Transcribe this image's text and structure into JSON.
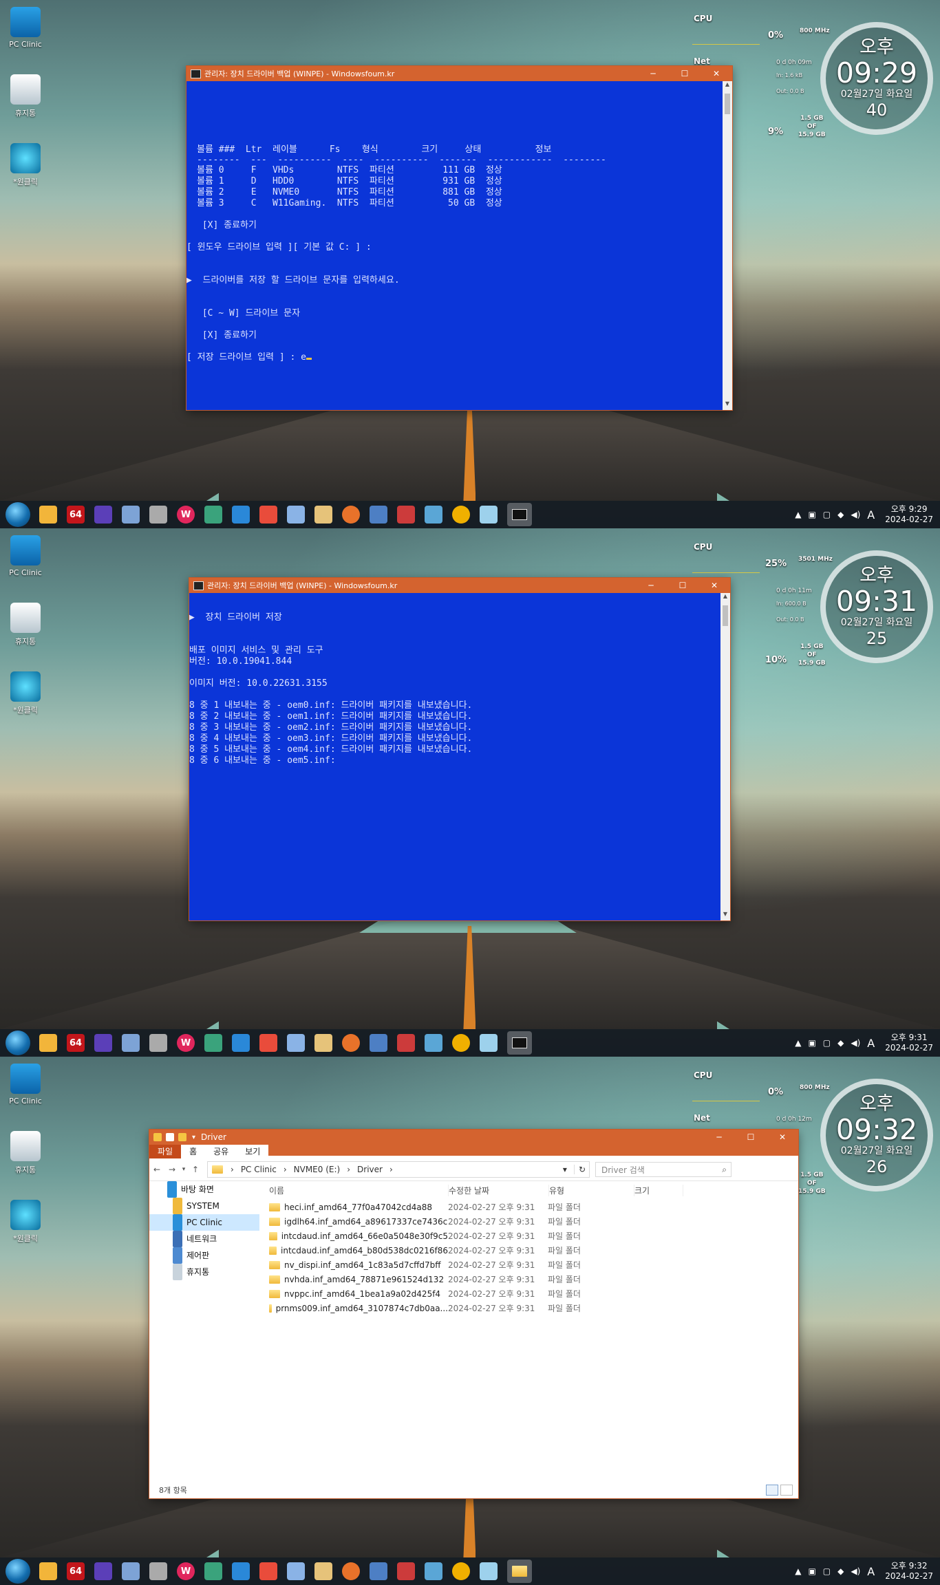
{
  "desktop": {
    "icons": [
      {
        "label": "PC Clinic"
      },
      {
        "label": "휴지통"
      },
      {
        "label": "*원클릭"
      }
    ]
  },
  "taskbar": {
    "icons": [
      "64",
      "W"
    ],
    "tray_lang": "A"
  },
  "gadgets": {
    "cpu_label": "CPU",
    "net_label": "Net",
    "mem_line1": "1.5 GB",
    "mem_line2": "OF",
    "mem_line3": "15.9 GB"
  },
  "panels": [
    {
      "clock": {
        "ampm": "오후",
        "time": "09:29",
        "date": "02월27일 화요일",
        "seconds": "40"
      },
      "taskbar_time": "오후 9:29",
      "taskbar_date": "2024-02-27",
      "cpu_pct": "0%",
      "cpu_mhz": "800 MHz",
      "net_uptime": "0 d 0h 09m",
      "net_in": "In: 1.6 kB",
      "net_out": "Out: 0.0 B",
      "mem_pct": "9%",
      "window_title": "관리자:  장치 드라이버 백업 (WINPE) - Windowsfoum.kr",
      "console_lines": [
        "볼륨 ###  Ltr  레이블      Fs    형식        크기     상태          정보",
        "--------  ---  ----------  ----  ----------  -------  ------------  --------",
        "볼륨 0     F   VHDs        NTFS  파티션         111 GB  정상",
        "볼륨 1     D   HDD0        NTFS  파티션         931 GB  정상",
        "볼륨 2     E   NVME0       NTFS  파티션         881 GB  정상",
        "볼륨 3     C   W11Gaming.  NTFS  파티션          50 GB  정상",
        "",
        " [X] 종료하기",
        "",
        "[ 윈도우 드라이브 입력 ][ 기본 값 C: ] :",
        "",
        "",
        "▶  드라이버를 저장 할 드라이브 문자를 입력하세요.",
        "",
        "",
        " [C ~ W] 드라이브 문자",
        "",
        " [X] 종료하기",
        "",
        "[ 저장 드라이브 입력 ] : e"
      ]
    },
    {
      "clock": {
        "ampm": "오후",
        "time": "09:31",
        "date": "02월27일 화요일",
        "seconds": "25"
      },
      "taskbar_time": "오후 9:31",
      "taskbar_date": "2024-02-27",
      "cpu_pct": "25%",
      "cpu_mhz": "3501 MHz",
      "net_uptime": "0 d 0h 11m",
      "net_in": "In: 600.0 B",
      "net_out": "Out: 0.0 B",
      "mem_pct": "10%",
      "window_title": "관리자:  장치 드라이버 백업 (WINPE) - Windowsfoum.kr",
      "console_lines": [
        "▶  장치 드라이버 저장",
        "",
        "",
        "배포 이미지 서비스 및 관리 도구",
        "버전: 10.0.19041.844",
        "",
        "이미지 버전: 10.0.22631.3155",
        "",
        "8 중 1 내보내는 중 - oem0.inf: 드라이버 패키지를 내보냈습니다.",
        "8 중 2 내보내는 중 - oem1.inf: 드라이버 패키지를 내보냈습니다.",
        "8 중 3 내보내는 중 - oem2.inf: 드라이버 패키지를 내보냈습니다.",
        "8 중 4 내보내는 중 - oem3.inf: 드라이버 패키지를 내보냈습니다.",
        "8 중 5 내보내는 중 - oem4.inf: 드라이버 패키지를 내보냈습니다.",
        "8 중 6 내보내는 중 - oem5.inf:"
      ]
    },
    {
      "clock": {
        "ampm": "오후",
        "time": "09:32",
        "date": "02월27일 화요일",
        "seconds": "26"
      },
      "taskbar_time": "오후 9:32",
      "taskbar_date": "2024-02-27",
      "cpu_pct": "0%",
      "cpu_mhz": "800 MHz",
      "net_uptime": "0 d 0h 12m",
      "explorer": {
        "title": "Driver",
        "ribbon_tabs": [
          "파일",
          "홈",
          "공유",
          "보기"
        ],
        "breadcrumb": [
          "PC Clinic",
          "NVME0 (E:)",
          "Driver"
        ],
        "search_placeholder": "Driver 검색",
        "tree": [
          "바탕 화면",
          "SYSTEM",
          "PC Clinic",
          "네트워크",
          "제어판",
          "휴지통"
        ],
        "columns": [
          "이름",
          "수정한 날짜",
          "유형",
          "크기"
        ],
        "files": [
          {
            "name": "heci.inf_amd64_77f0a47042cd4a88",
            "date": "2024-02-27 오후 9:31",
            "type": "파일 폴더"
          },
          {
            "name": "igdlh64.inf_amd64_a89617337ce7436c",
            "date": "2024-02-27 오후 9:31",
            "type": "파일 폴더"
          },
          {
            "name": "intcdaud.inf_amd64_66e0a5048e30f9c5",
            "date": "2024-02-27 오후 9:31",
            "type": "파일 폴더"
          },
          {
            "name": "intcdaud.inf_amd64_b80d538dc0216f86",
            "date": "2024-02-27 오후 9:31",
            "type": "파일 폴더"
          },
          {
            "name": "nv_dispi.inf_amd64_1c83a5d7cffd7bff",
            "date": "2024-02-27 오후 9:31",
            "type": "파일 폴더"
          },
          {
            "name": "nvhda.inf_amd64_78871e961524d132",
            "date": "2024-02-27 오후 9:31",
            "type": "파일 폴더"
          },
          {
            "name": "nvppc.inf_amd64_1bea1a9a02d425f4",
            "date": "2024-02-27 오후 9:31",
            "type": "파일 폴더"
          },
          {
            "name": "prnms009.inf_amd64_3107874c7db0aa...",
            "date": "2024-02-27 오후 9:31",
            "type": "파일 폴더"
          }
        ],
        "status": "8개 항목"
      }
    }
  ],
  "colors": {
    "console_bg": "#0b35d8",
    "titlebar": "#d4632f",
    "folder": "#f0b93b"
  }
}
